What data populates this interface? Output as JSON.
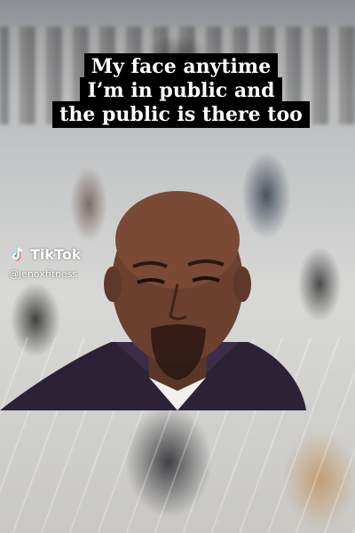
{
  "caption": {
    "line1": "My face anytime",
    "line2": "I’m in public and",
    "line3": "the public is there too"
  },
  "watermark": {
    "brand": "TikTok",
    "handle": "@jenoxfitness",
    "icon": "tiktok-logo-icon"
  },
  "colors": {
    "caption_bg": "#000000",
    "caption_text": "#ffffff",
    "tiktok_cyan": "#25f4ee",
    "tiktok_red": "#fe2c55"
  }
}
